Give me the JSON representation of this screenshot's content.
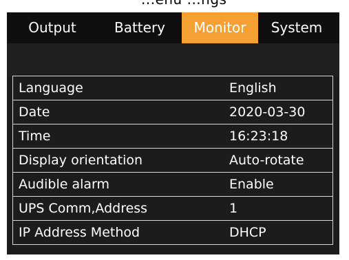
{
  "header_fragment": "...enu ...ngs",
  "tabs": [
    {
      "label": "Output",
      "active": false
    },
    {
      "label": "Battery",
      "active": false
    },
    {
      "label": "Monitor",
      "active": true
    },
    {
      "label": "System",
      "active": false
    }
  ],
  "settings": [
    {
      "label": "Language",
      "value": "English"
    },
    {
      "label": "Date",
      "value": "2020-03-30"
    },
    {
      "label": "Time",
      "value": "16:23:18"
    },
    {
      "label": "Display orientation",
      "value": "Auto-rotate"
    },
    {
      "label": "Audible alarm",
      "value": "Enable"
    },
    {
      "label": "UPS Comm,Address",
      "value": "1"
    },
    {
      "label": "IP Address Method",
      "value": "DHCP"
    }
  ],
  "colors": {
    "active_tab": "#f5a033",
    "background": "#1c1c1c",
    "text": "#ffffff",
    "grid_line": "#d8d8d8"
  }
}
